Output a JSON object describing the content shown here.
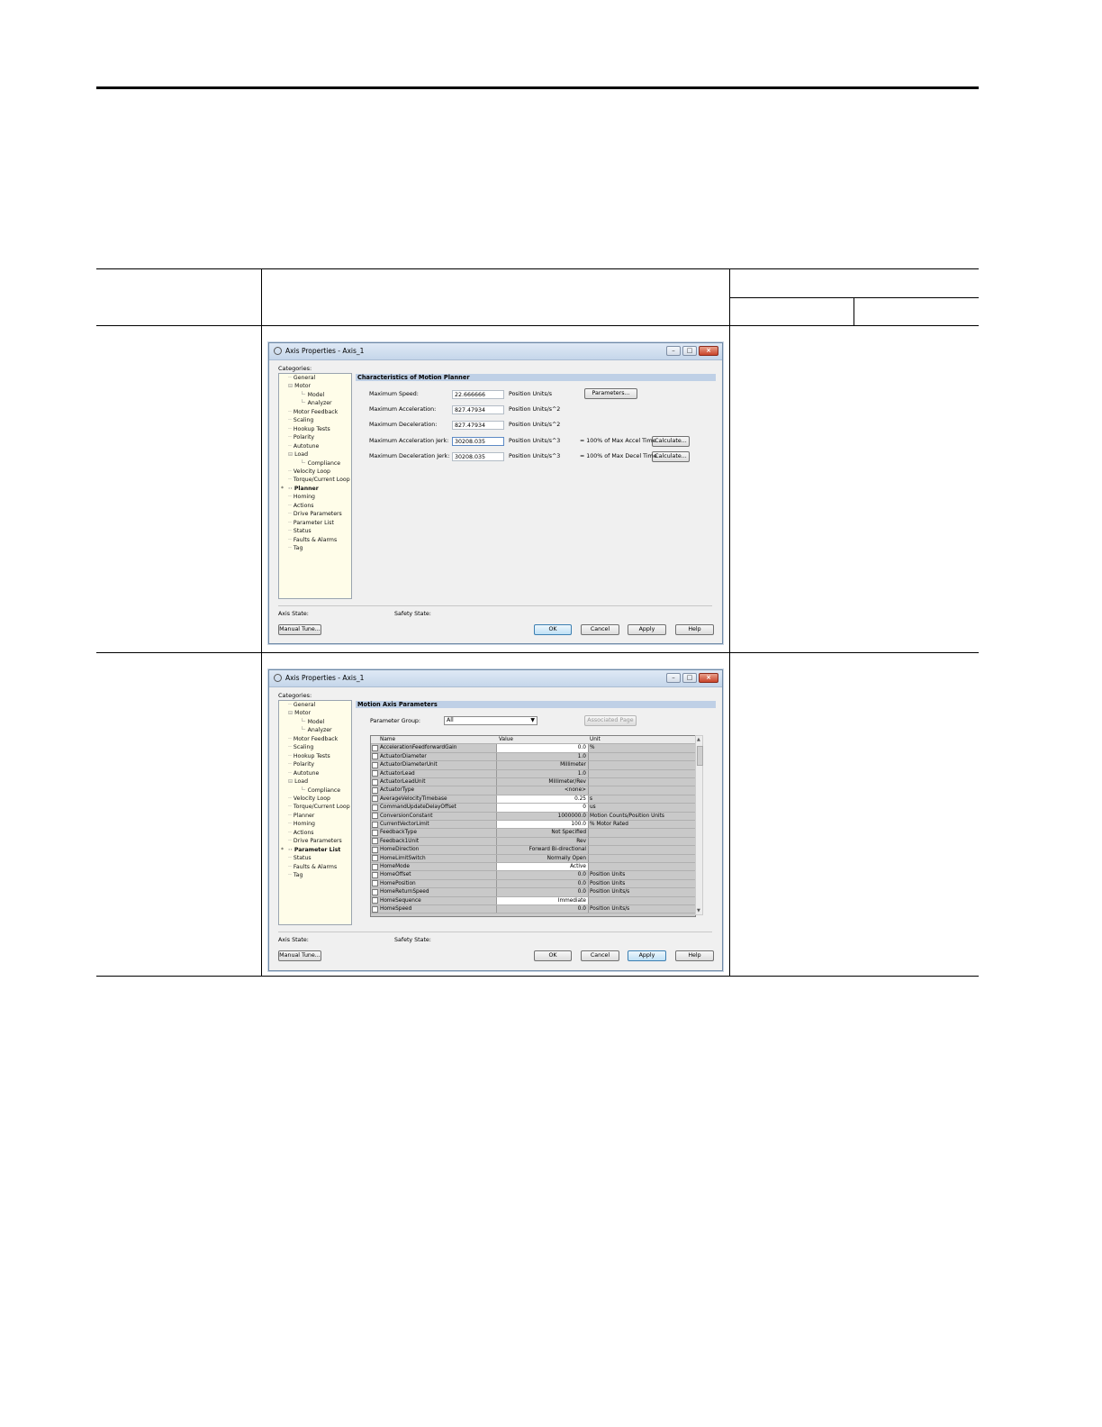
{
  "dialog1": {
    "title": "Axis Properties - Axis_1",
    "categories_label": "Categories:",
    "tree": [
      "General",
      "Motor",
      "Model",
      "Analyzer",
      "Motor Feedback",
      "Scaling",
      "Hookup Tests",
      "Polarity",
      "Autotune",
      "Load",
      "Compliance",
      "Velocity Loop",
      "Torque/Current Loop",
      "Planner",
      "Homing",
      "Actions",
      "Drive Parameters",
      "Parameter List",
      "Status",
      "Faults & Alarms",
      "Tag"
    ],
    "panel_title": "Characteristics of Motion Planner",
    "fields": [
      {
        "label": "Maximum Speed:",
        "value": "22.666666",
        "unit": "Position Units/s"
      },
      {
        "label": "Maximum Acceleration:",
        "value": "827.47934",
        "unit": "Position Units/s^2"
      },
      {
        "label": "Maximum Deceleration:",
        "value": "827.47934",
        "unit": "Position Units/s^2"
      },
      {
        "label": "Maximum Acceleration Jerk:",
        "value": "30208.035",
        "unit": "Position Units/s^3",
        "note": "= 100% of Max Accel Time"
      },
      {
        "label": "Maximum Deceleration Jerk:",
        "value": "30208.035",
        "unit": "Position Units/s^3",
        "note": "= 100% of Max Decel Time"
      }
    ],
    "parameters_button": "Parameters...",
    "calculate_button": "Calculate...",
    "axis_state": "Axis State:",
    "safety_state": "Safety State:",
    "manual_tune": "Manual Tune...",
    "ok": "OK",
    "cancel": "Cancel",
    "apply": "Apply",
    "help": "Help"
  },
  "dialog2": {
    "title": "Axis Properties - Axis_1",
    "categories_label": "Categories:",
    "tree": [
      "General",
      "Motor",
      "Model",
      "Analyzer",
      "Motor Feedback",
      "Scaling",
      "Hookup Tests",
      "Polarity",
      "Autotune",
      "Load",
      "Compliance",
      "Velocity Loop",
      "Torque/Current Loop",
      "Planner",
      "Homing",
      "Actions",
      "Drive Parameters",
      "Parameter List",
      "Status",
      "Faults & Alarms",
      "Tag"
    ],
    "panel_title": "Motion Axis Parameters",
    "parameter_group_label": "Parameter Group:",
    "parameter_group_value": "All",
    "associated_page": "Associated Page",
    "columns": [
      "Name",
      "Value",
      "Unit"
    ],
    "rows": [
      {
        "name": "AccelerationFeedforwardGain",
        "value": "0.0",
        "unit": "%",
        "editable": true
      },
      {
        "name": "ActuatorDiameter",
        "value": "1.0",
        "unit": "",
        "editable": false
      },
      {
        "name": "ActuatorDiameterUnit",
        "value": "Millimeter",
        "unit": "",
        "editable": false
      },
      {
        "name": "ActuatorLead",
        "value": "1.0",
        "unit": "",
        "editable": false
      },
      {
        "name": "ActuatorLeadUnit",
        "value": "Millimeter/Rev",
        "unit": "",
        "editable": false
      },
      {
        "name": "ActuatorType",
        "value": "<none>",
        "unit": "",
        "editable": false
      },
      {
        "name": "AverageVelocityTimebase",
        "value": "0.25",
        "unit": "s",
        "editable": true
      },
      {
        "name": "CommandUpdateDelayOffset",
        "value": "0",
        "unit": "us",
        "editable": true
      },
      {
        "name": "ConversionConstant",
        "value": "1000000.0",
        "unit": "Motion Counts/Position Units",
        "editable": false
      },
      {
        "name": "CurrentVectorLimit",
        "value": "100.0",
        "unit": "% Motor Rated",
        "editable": true
      },
      {
        "name": "FeedbackType",
        "value": "Not Specified",
        "unit": "",
        "editable": false
      },
      {
        "name": "Feedback1Unit",
        "value": "Rev",
        "unit": "",
        "editable": false
      },
      {
        "name": "HomeDirection",
        "value": "Forward Bi-directional",
        "unit": "",
        "editable": false
      },
      {
        "name": "HomeLimitSwitch",
        "value": "Normally Open",
        "unit": "",
        "editable": false
      },
      {
        "name": "HomeMode",
        "value": "Active",
        "unit": "",
        "editable": true
      },
      {
        "name": "HomeOffset",
        "value": "0.0",
        "unit": "Position Units",
        "editable": false
      },
      {
        "name": "HomePosition",
        "value": "0.0",
        "unit": "Position Units",
        "editable": false
      },
      {
        "name": "HomeReturnSpeed",
        "value": "0.0",
        "unit": "Position Units/s",
        "editable": false
      },
      {
        "name": "HomeSequence",
        "value": "Immediate",
        "unit": "",
        "editable": true
      },
      {
        "name": "HomeSpeed",
        "value": "0.0",
        "unit": "Position Units/s",
        "editable": false
      }
    ],
    "axis_state": "Axis State:",
    "safety_state": "Safety State:",
    "manual_tune": "Manual Tune...",
    "ok": "OK",
    "cancel": "Cancel",
    "apply": "Apply",
    "help": "Help"
  }
}
